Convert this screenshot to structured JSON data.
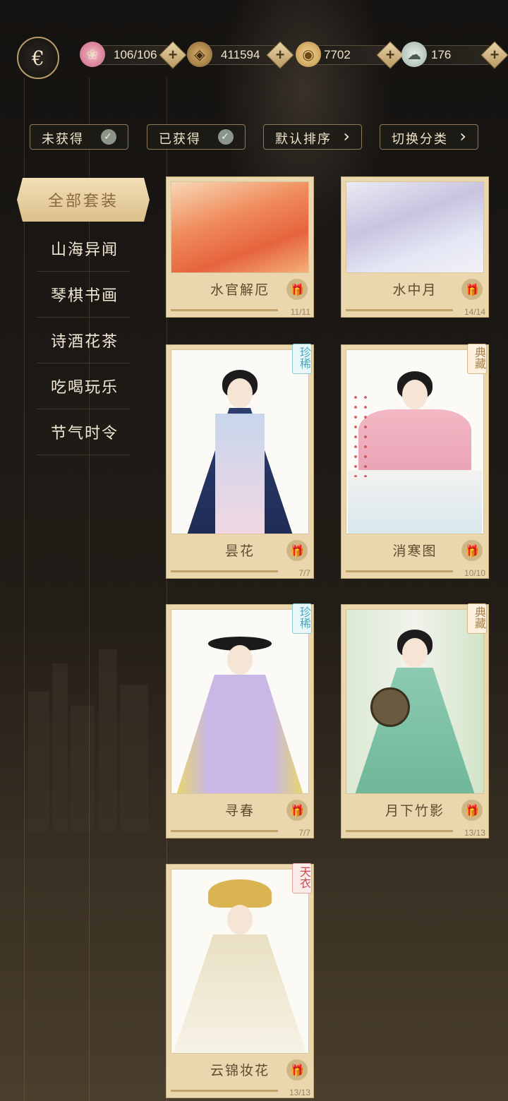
{
  "resources": [
    {
      "icon": "lotus-icon",
      "value": "106/106"
    },
    {
      "icon": "coin-icon",
      "value": "411594"
    },
    {
      "icon": "gold-ingot-icon",
      "value": "7702"
    },
    {
      "icon": "jade-icon",
      "value": "176"
    }
  ],
  "filters": {
    "unobtained": "未获得",
    "obtained": "已获得",
    "sort": "默认排序",
    "switch_category": "切换分类"
  },
  "sidebar": {
    "active": "全部套装",
    "items": [
      "山海异闻",
      "琴棋书画",
      "诗酒花茶",
      "吃喝玩乐",
      "节气时令"
    ]
  },
  "cards": [
    {
      "name": "水官解厄",
      "count": "11/11",
      "tag": ""
    },
    {
      "name": "水中月",
      "count": "14/14",
      "tag": ""
    },
    {
      "name": "昙花",
      "count": "7/7",
      "tag": "珍稀"
    },
    {
      "name": "消寒图",
      "count": "10/10",
      "tag": "典藏"
    },
    {
      "name": "寻春",
      "count": "7/7",
      "tag": "珍稀"
    },
    {
      "name": "月下竹影",
      "count": "13/13",
      "tag": "典藏"
    },
    {
      "name": "云锦妆花",
      "count": "13/13",
      "tag": "天衣"
    }
  ],
  "colors": {
    "accent": "#dcc08c",
    "card": "#ead7ae",
    "rare": "#4aa6b3",
    "collection": "#a8804a",
    "sky": "#cc4b4b"
  }
}
